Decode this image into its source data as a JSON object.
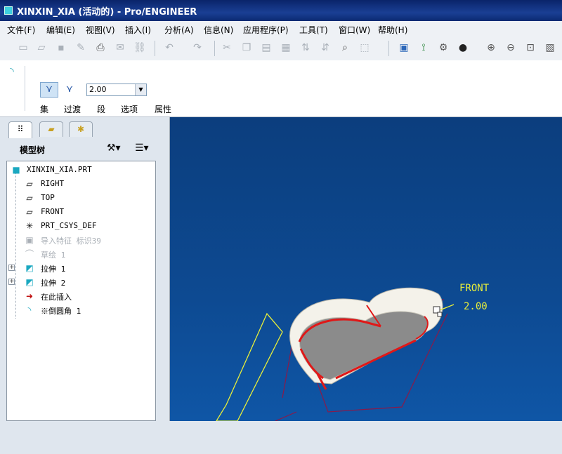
{
  "window": {
    "title": "XINXIN_XIA (活动的) - Pro/ENGINEER"
  },
  "menu": [
    "文件(F)",
    "编辑(E)",
    "视图(V)",
    "插入(I)",
    "分析(A)",
    "信息(N)",
    "应用程序(P)",
    "工具(T)",
    "窗口(W)",
    "帮助(H)"
  ],
  "dashboard": {
    "value": "2.00",
    "labels": [
      "集",
      "过渡",
      "段",
      "选项",
      "属性"
    ]
  },
  "model_tree": {
    "title": "模型树",
    "items": [
      {
        "label": "XINXIN_XIA.PRT",
        "icon": "part-icon"
      },
      {
        "label": "RIGHT",
        "icon": "datum-plane-icon"
      },
      {
        "label": "TOP",
        "icon": "datum-plane-icon"
      },
      {
        "label": "FRONT",
        "icon": "datum-plane-icon"
      },
      {
        "label": "PRT_CSYS_DEF",
        "icon": "csys-icon"
      },
      {
        "label": "导入特征 标识39",
        "icon": "import-feature-icon",
        "dim": true
      },
      {
        "label": "草绘 1",
        "icon": "sketch-icon",
        "dim": true
      },
      {
        "label": "拉伸 1",
        "icon": "extrude-icon"
      },
      {
        "label": "拉伸 2",
        "icon": "extrude-icon"
      },
      {
        "label": "在此插入",
        "icon": "insert-here-arrow-icon"
      },
      {
        "label": "※倒圆角 1",
        "icon": "round-icon"
      }
    ]
  },
  "viewport": {
    "front_label": "FRONT",
    "dim_value": "2.00",
    "colors": {
      "background": "#0d4a92",
      "datum": "#e8ee3a",
      "edge_highlight": "#e01818",
      "body": "#f4f2ea",
      "face": "#8b8b8b"
    }
  }
}
